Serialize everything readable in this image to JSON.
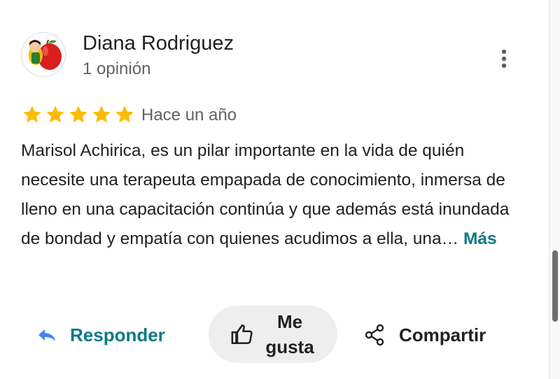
{
  "reviewer": {
    "name": "Diana Rodriguez",
    "review_count": "1 opinión"
  },
  "rating": {
    "stars": 5,
    "max": 5,
    "star_color": "#fbbc04"
  },
  "review": {
    "date": "Hace un año",
    "text": "Marisol Achirica, es un pilar importante en la vida de quién necesite una terapeuta empapada de conocimiento, inmersa de lleno en una capacitación continúa y que además está inundada de bondad y empatía con quienes acudimos a ella, una…",
    "more_label": "Más"
  },
  "actions": {
    "reply_label": "Responder",
    "like_label": "Me gusta",
    "share_label": "Compartir"
  },
  "colors": {
    "accent": "#0b7a87",
    "reply_icon": "#4285f4"
  },
  "icons": {
    "more": "more-vert-icon",
    "reply": "reply-arrow-icon",
    "like": "thumbs-up-icon",
    "share": "share-icon"
  }
}
